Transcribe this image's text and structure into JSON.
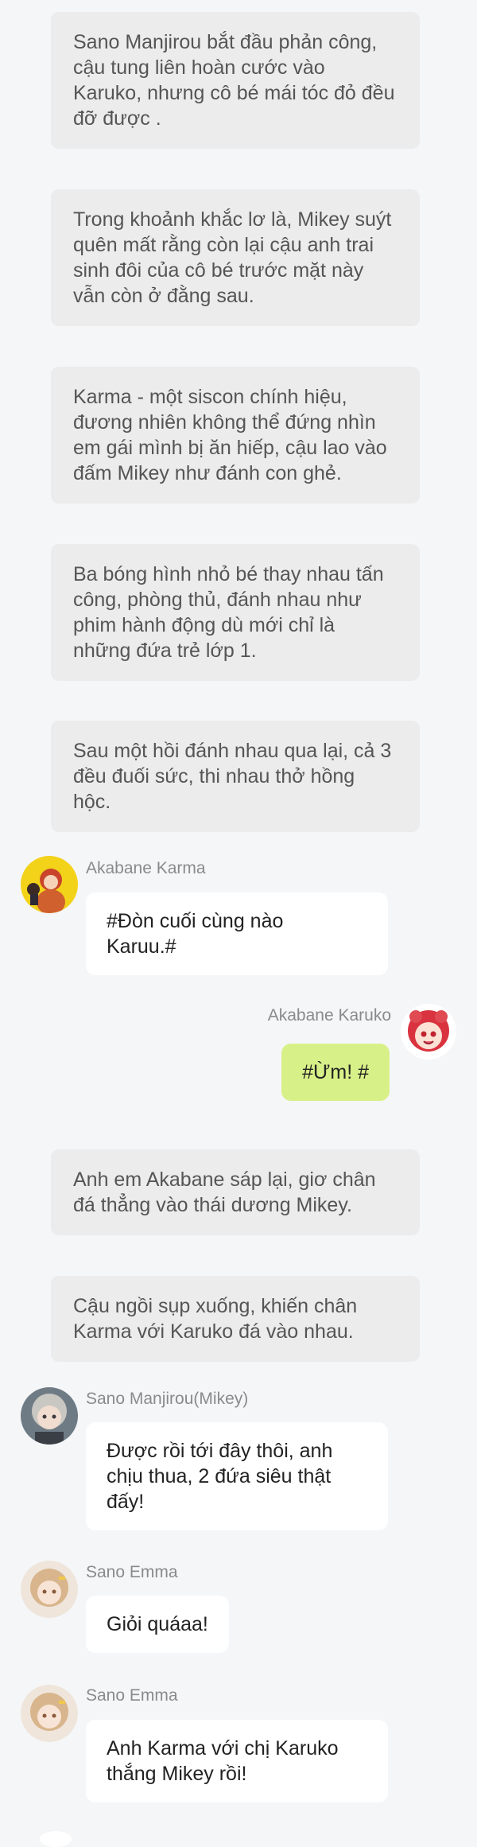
{
  "narrations": [
    "Sano Manjirou bắt đầu phản công, cậu tung liên hoàn cước vào Karuko, nhưng cô bé mái tóc đỏ đều đỡ được .",
    "Trong khoảnh khắc lơ là, Mikey suýt quên mất rằng còn lại cậu anh trai sinh đôi của cô bé trước mặt này vẫn còn ở đằng sau.",
    "Karma - một siscon chính hiệu, đương nhiên không thể đứng nhìn em gái mình bị ăn hiếp, cậu lao vào đấm Mikey như đánh con ghẻ.",
    "Ba bóng hình nhỏ bé thay nhau tấn công, phòng thủ, đánh nhau như phim hành động dù mới chỉ là những đứa trẻ lớp 1.",
    "Sau một hồi đánh nhau qua lại, cả 3 đều đuối sức, thi nhau thở hồng hộc.",
    "Anh em Akabane sáp lại, giơ chân đá thẳng vào thái dương Mikey.",
    "Cậu ngồi sụp xuống, khiến chân Karma với Karuko đá vào nhau."
  ],
  "messages": [
    {
      "sender": "Akabane Karma",
      "text": "#Đòn cuối cùng nào Karuu.#",
      "avatar": "karma-avatar"
    },
    {
      "sender": "Akabane Karuko",
      "text": "#Ừm! #",
      "avatar": "karuko-avatar"
    },
    {
      "sender": "Sano Manjirou(Mikey)",
      "text": "Được rồi tới đây thôi, anh chịu thua, 2 đứa siêu thật đấy!",
      "avatar": "mikey-avatar"
    },
    {
      "sender": "Sano Emma",
      "text": "Giỏi quáaa!",
      "avatar": "emma-avatar"
    },
    {
      "sender": "Sano Emma",
      "text": "Anh Karma với chị Karuko thắng Mikey rồi!",
      "avatar": "emma-avatar"
    }
  ],
  "colors": {
    "background": "#f5f6f8",
    "narration_bg": "#ececec",
    "own_bubble": "#d8f088",
    "bubble": "#ffffff"
  }
}
